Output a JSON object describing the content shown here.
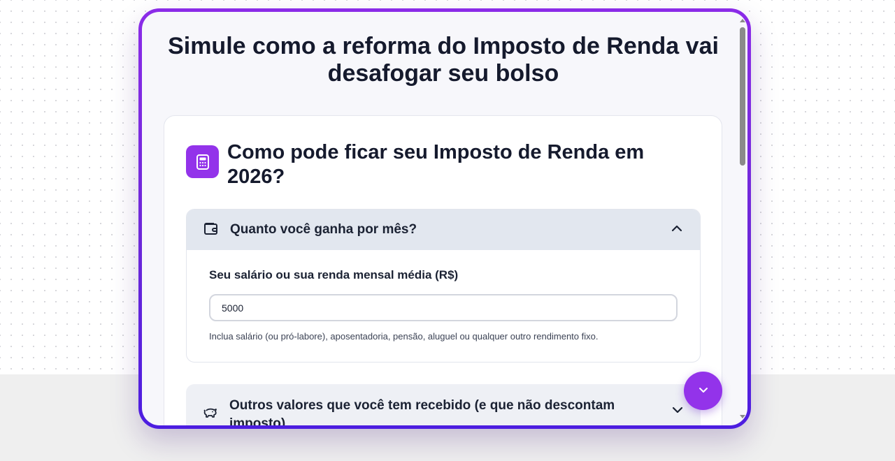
{
  "page": {
    "title": "Simule como a reforma do Imposto de Renda vai desafogar seu bolso"
  },
  "calculator": {
    "title": "Como pode ficar seu Imposto de Renda em 2026?",
    "icon": "calculator-icon"
  },
  "income_section": {
    "title": "Quanto você ganha por mês?",
    "icon": "wallet-icon",
    "expanded": true,
    "field_label": "Seu salário ou sua renda mensal média (R$)",
    "field_value": "5000",
    "hint": "Inclua salário (ou pró-labore), aposentadoria, pensão, aluguel ou qualquer outro rendimento fixo."
  },
  "other_income_section": {
    "title": "Outros valores que você tem recebido (e que não descontam imposto)",
    "icon": "piggy-bank-icon",
    "expanded": false
  },
  "scroll_down_button": {
    "icon": "chevron-down-icon"
  },
  "colors": {
    "accent": "#9333ea",
    "frame_gradient_start": "#8b2be8",
    "frame_gradient_end": "#4c1de0",
    "section_header_bg": "#e2e7ef"
  }
}
